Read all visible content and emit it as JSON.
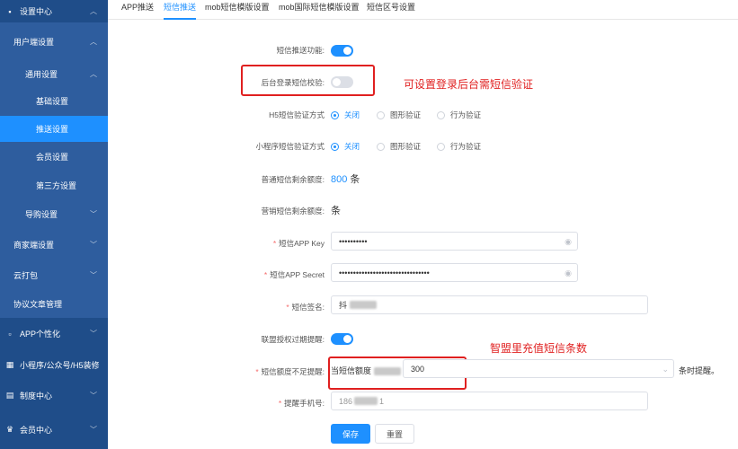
{
  "sidebar": {
    "items": [
      {
        "label": "设置中心",
        "icon": "settings-icon"
      },
      {
        "label": "用户端设置"
      },
      {
        "label": "通用设置"
      },
      {
        "label": "基础设置"
      },
      {
        "label": "推送设置"
      },
      {
        "label": "会员设置"
      },
      {
        "label": "第三方设置"
      },
      {
        "label": "导购设置"
      },
      {
        "label": "商家端设置"
      },
      {
        "label": "云打包"
      },
      {
        "label": "协议文章管理"
      },
      {
        "label": "APP个性化",
        "icon": "app-icon"
      },
      {
        "label": "小程序/公众号/H5装修",
        "icon": "grid-icon"
      },
      {
        "label": "制度中心",
        "icon": "document-icon"
      },
      {
        "label": "会员中心",
        "icon": "crown-icon"
      }
    ]
  },
  "tabs": [
    {
      "label": "APP推送"
    },
    {
      "label": "短信推送"
    },
    {
      "label": "mob短信模版设置"
    },
    {
      "label": "mob国际短信模版设置"
    },
    {
      "label": "短信区号设置"
    }
  ],
  "form": {
    "sms_push_label": "短信推送功能:",
    "sms_push_on": true,
    "admin_login_label": "后台登录短信校验:",
    "admin_login_on": false,
    "h5_label": "H5短信验证方式",
    "h5_options": [
      "关闭",
      "图形验证",
      "行为验证"
    ],
    "mini_label": "小程序短信验证方式",
    "mini_options": [
      "关闭",
      "图形验证",
      "行为验证"
    ],
    "normal_remaining_label": "普通短信剩余额度:",
    "normal_remaining_value": "800",
    "unit": "条",
    "marketing_remaining_label": "营销短信剩余额度:",
    "marketing_remaining_value": "条",
    "appkey_label": "短信APP Key",
    "appkey_value": "••••••••••",
    "appsecret_label": "短信APP Secret",
    "appsecret_value": "••••••••••••••••••••••••••••••••",
    "signature_label": "短信签名:",
    "signature_value": "抖",
    "alliance_label": "联盟授权过期提醒:",
    "alliance_on": true,
    "quota_label": "短信额度不足提醒:",
    "quota_prefix": "当短信额度",
    "quota_value": "300",
    "quota_suffix": "条时提醒。",
    "phone_label": "提醒手机号:",
    "phone_value": "186",
    "phone_value_end": "1",
    "save_label": "保存",
    "reset_label": "重置"
  },
  "annotations": {
    "admin_note": "可设置登录后台需短信验证",
    "quota_note": "智盟里充值短信条数",
    "color": "#e02020"
  },
  "colors": {
    "sidebar_bg": "#2b5797",
    "accent": "#1e90ff",
    "required": "#f56c6c"
  }
}
